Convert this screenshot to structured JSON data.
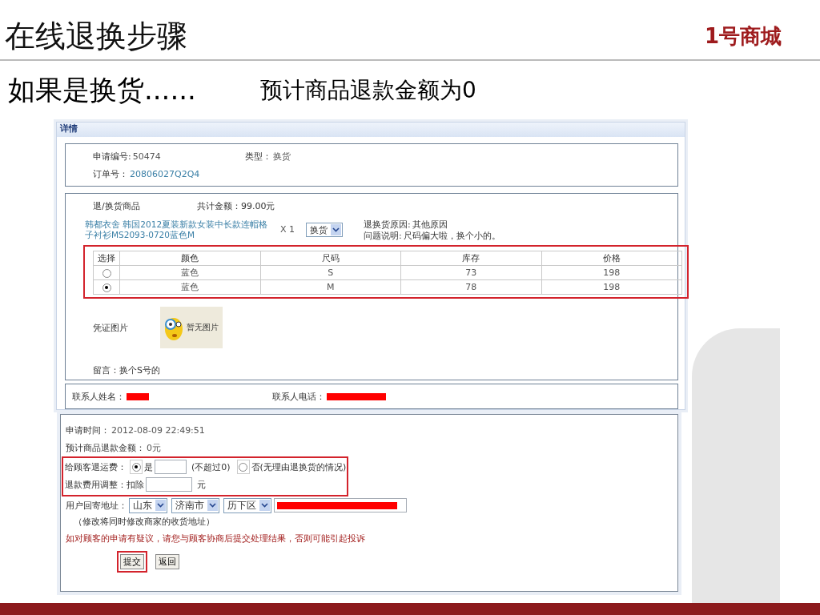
{
  "slide": {
    "title": "在线退换步骤",
    "logo": "1号商城",
    "subtitle": "如果是换货......",
    "note": "预计商品退款金额为0"
  },
  "detail_panel": {
    "title": "详情",
    "request_no_label": "申请编号:",
    "request_no": "50474",
    "type_label": "类型：",
    "type": "换货",
    "order_label": "订单号：",
    "order_no": "20806027Q2Q4",
    "items_label": "退/换货商品",
    "total": "共计金额：99.00元",
    "product_name": "韩都衣舍 韩国2012夏装新款女装中长款连帽格子衬衫MS2093-0720蓝色M",
    "quantity": "X 1",
    "action_select": "换货",
    "reason_label": "退换货原因:",
    "reason": "其他原因",
    "desc_label": "问题说明:",
    "desc": "尺码偏大啦，换个小的。",
    "table": {
      "highlighted": true,
      "columns": [
        "选择",
        "颜色",
        "尺码",
        "库存",
        "价格"
      ],
      "rows": [
        {
          "selected": false,
          "cells": [
            "",
            "蓝色",
            "S",
            "73",
            "198"
          ]
        },
        {
          "selected": true,
          "cells": [
            "",
            "蓝色",
            "M",
            "78",
            "198"
          ]
        }
      ]
    },
    "evidence_label": "凭证图片",
    "evidence_image_text": "暂无图片",
    "message": "留言：换个S号的",
    "contact_name_label": "联系人姓名：",
    "contact_phone_label": "联系人电话："
  },
  "action_panel": {
    "request_time_label": "申请时间：",
    "request_time": "2012-08-09 22:49:51",
    "refund_label": "预计商品退款金额：",
    "refund": "0元",
    "fee_group_highlighted": true,
    "shipping_label": "给顾客退运费：",
    "shipping_yes": {
      "label": "是",
      "selected": true,
      "hint": "(不超过0)"
    },
    "shipping_no": {
      "label": "否(无理由退换货的情况)",
      "selected": false
    },
    "adjust_label": "退款费用调整：扣除",
    "adjust_unit": "元",
    "address_label": "用户回寄地址：",
    "address_selects": [
      "山东",
      "济南市",
      "历下区"
    ],
    "address_note": "（修改将同时修改商家的收货地址）",
    "warning": "如对顾客的申请有疑议，请您与顾客协商后提交处理结果，否则可能引起投诉",
    "buttons": [
      {
        "label": "提交",
        "highlighted": true
      },
      {
        "label": "返回",
        "highlighted": false
      }
    ]
  }
}
